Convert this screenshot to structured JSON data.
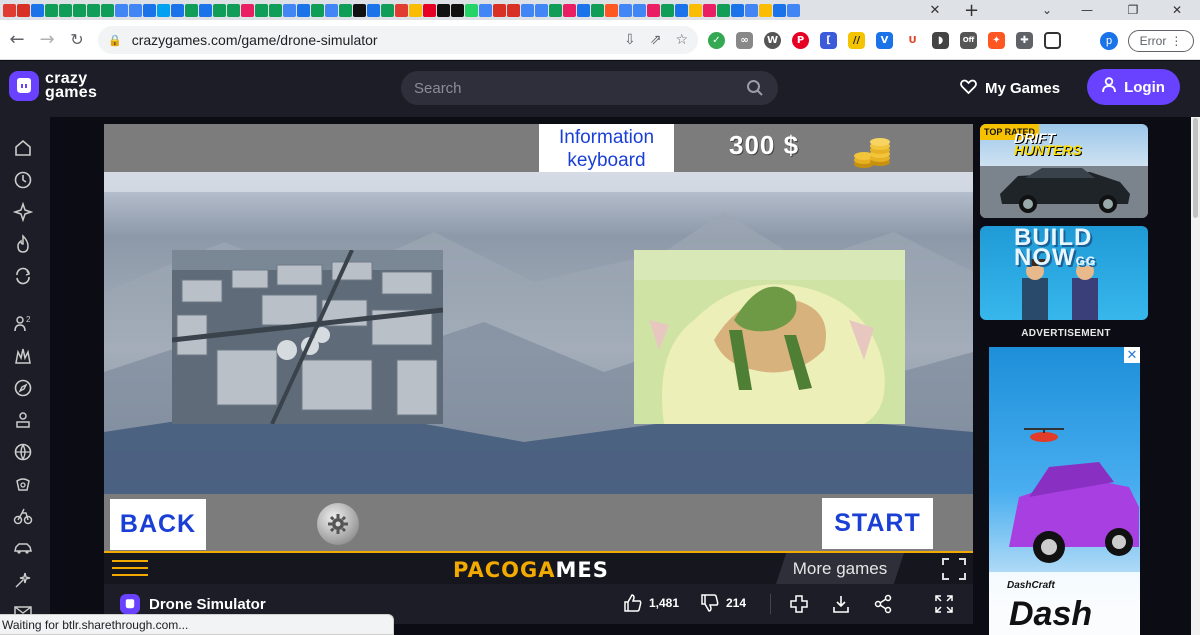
{
  "browser": {
    "url": "crazygames.com/game/drone-simulator",
    "error_label": "Error",
    "profile_initial": "p",
    "tab_close_glyph": "✕",
    "new_tab_glyph": "+",
    "favicons": [
      "#e03c31",
      "#d93025",
      "#1a73e8",
      "#0f9d58",
      "#0f9d58",
      "#0f9d58",
      "#0f9d58",
      "#0f9d58",
      "#4285f4",
      "#4285f4",
      "#1a73e8",
      "#00a1f1",
      "#1a73e8",
      "#0f9d58",
      "#1a73e8",
      "#0f9d58",
      "#0f9d58",
      "#e91e63",
      "#0f9d58",
      "#0f9d58",
      "#4285f4",
      "#1a73e8",
      "#0f9d58",
      "#4285f4",
      "#0f9d58",
      "#111111",
      "#1a73e8",
      "#0f9d58",
      "#e03c31",
      "#fbbc04",
      "#e60023",
      "#111111",
      "#111111",
      "#25d366",
      "#4285f4",
      "#d93025",
      "#d93025",
      "#4285f4",
      "#4285f4",
      "#0f9d58",
      "#e91e63",
      "#1a73e8",
      "#0f9d58",
      "#ff5722",
      "#4285f4",
      "#4285f4",
      "#e91e63",
      "#0f9d58",
      "#1a73e8",
      "#fbbc04",
      "#e91e63",
      "#0f9d58",
      "#1a73e8",
      "#4285f4",
      "#fbbc04",
      "#1a73e8",
      "#4285f4"
    ]
  },
  "site": {
    "logo_line1": "crazy",
    "logo_line2": "games",
    "search_placeholder": "Search",
    "my_games_label": "My Games",
    "login_label": "Login",
    "accent": "#6842ff"
  },
  "game": {
    "info_line1": "Information",
    "info_line2": "keyboard",
    "money": "300 $",
    "back_label": "BACK",
    "start_label": "START",
    "brand_part1": "PACOGA",
    "brand_part2": "MES",
    "more_games_label": "More games",
    "title": "Drone Simulator",
    "likes": "1,481",
    "dislikes": "214"
  },
  "sidebar": {
    "items": [
      "home-icon",
      "recent-icon",
      "new-icon",
      "trending-icon",
      "updated-icon",
      "multiplayer-icon",
      "action-icon",
      "adventure-icon",
      "idle-icon",
      "sports-icon",
      "casual-icon",
      "bike-icon",
      "car-icon",
      "shooting-icon",
      "mail-icon"
    ]
  },
  "right": {
    "top_rated": "TOP RATED",
    "thumb1_line1": "DRIFT",
    "thumb1_line2": "HUNTERS",
    "thumb2_line1": "BUILD",
    "thumb2_line2": "NOW",
    "thumb2_suffix": "GG",
    "ad_label": "ADVERTISEMENT",
    "ad_brand_small": "DashCraft",
    "ad_brand_big": "Dash"
  },
  "status": {
    "text": "Waiting for btlr.sharethrough.com..."
  }
}
